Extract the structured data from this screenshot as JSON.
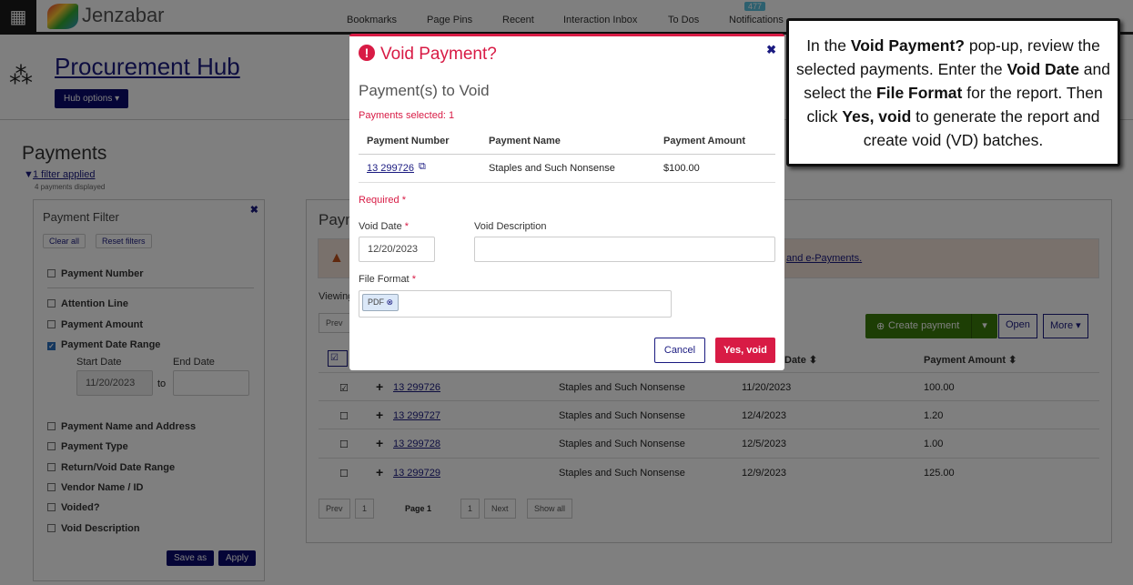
{
  "topbar": {
    "brand": "Jenzabar",
    "nav": [
      "Bookmarks",
      "Page Pins",
      "Recent",
      "Interaction Inbox",
      "To Dos",
      "Notifications"
    ],
    "notification_count": "477"
  },
  "hub": {
    "title": "Procurement Hub",
    "options": "Hub options ▾"
  },
  "payments": {
    "title": "Payments",
    "filter_link": "1 filter applied",
    "displayed": "4 payments displayed"
  },
  "filter_panel": {
    "title": "Payment Filter",
    "clear_all": "Clear all",
    "reset": "Reset filters",
    "items": [
      "Payment Number",
      "Attention Line",
      "Payment Amount",
      "Payment Date Range",
      "Payment Name and Address",
      "Payment Type",
      "Return/Void Date Range",
      "Vendor Name / ID",
      "Voided?",
      "Void Description"
    ],
    "start_label": "Start Date",
    "end_label": "End Date",
    "start_value": "11/20/2023",
    "to": "to",
    "save_as": "Save as",
    "apply": "Apply"
  },
  "main": {
    "title_partial": "Paym",
    "warning_link": "and e-Payments.",
    "viewing": "Viewing",
    "create": "Create payment",
    "open": "Open",
    "more": "More ▾",
    "headers": {
      "date": "Date ⬍",
      "amount": "Payment Amount ⬍"
    },
    "rows": [
      {
        "number": "13 299726",
        "name": "Staples and Such Nonsense",
        "date": "11/20/2023",
        "amount": "100.00",
        "checked": true
      },
      {
        "number": "13 299727",
        "name": "Staples and Such Nonsense",
        "date": "12/4/2023",
        "amount": "1.20",
        "checked": false
      },
      {
        "number": "13 299728",
        "name": "Staples and Such Nonsense",
        "date": "12/5/2023",
        "amount": "1.00",
        "checked": false
      },
      {
        "number": "13 299729",
        "name": "Staples and Such Nonsense",
        "date": "12/9/2023",
        "amount": "125.00",
        "checked": false
      }
    ],
    "pager": {
      "prev": "Prev",
      "page_num": "1",
      "page_label": "Page 1",
      "next": "Next",
      "show_all": "Show all"
    }
  },
  "dialog": {
    "title": "Void Payment?",
    "subtitle": "Payment(s) to Void",
    "selected": "Payments selected: 1",
    "headers": [
      "Payment Number",
      "Payment Name",
      "Payment Amount"
    ],
    "row": {
      "number": "13 299726",
      "name": "Staples and Such Nonsense",
      "amount": "$100.00"
    },
    "required": "Required",
    "void_date_label": "Void Date",
    "void_date": "12/20/2023",
    "void_desc_label": "Void Description",
    "void_desc": "",
    "file_format_label": "File Format",
    "file_format": "PDF",
    "cancel": "Cancel",
    "confirm": "Yes, void"
  },
  "callout": {
    "text": "In the Void Payment? pop-up, review the selected payments. Enter the Void Date and select the File Format for the report. Then click Yes, void to generate the report and create void (VD) batches."
  }
}
